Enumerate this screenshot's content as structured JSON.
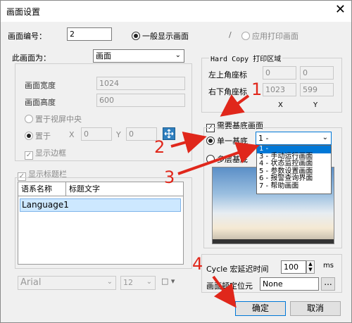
{
  "window": {
    "title": "画面设置",
    "close_glyph": "✕"
  },
  "screen_number": {
    "label": "画面编号：",
    "value": "2"
  },
  "mode": {
    "general_label": "一般显示画面",
    "print_label": "应用打印画面",
    "separator": "/"
  },
  "screen_type": {
    "label": "此画面为：",
    "value": "画面"
  },
  "size": {
    "width_label": "画面宽度",
    "width_value": "1024",
    "height_label": "画面高度",
    "height_value": "600"
  },
  "placement": {
    "center_label": "置于视屏中央",
    "place_label": "置于",
    "x_label": "X",
    "x_value": "0",
    "y_label": "Y",
    "y_value": "0"
  },
  "show_border_label": "显示边框",
  "show_title_bar_label": "显示标题栏",
  "title_table": {
    "headers": [
      "语系名称",
      "标题文字"
    ],
    "rows": [
      [
        "Language1",
        ""
      ]
    ]
  },
  "font": {
    "family": "Arial",
    "size": "12",
    "color_glyph": "□"
  },
  "hardcopy": {
    "label": "Hard Copy 打印区域",
    "top_left_label": "左上角座标",
    "bottom_right_label": "右下角座标",
    "tl_x": "0",
    "tl_y": "0",
    "br_x": "1023",
    "br_y": "599",
    "x_axis": "X",
    "y_axis": "Y"
  },
  "base": {
    "need_label": "需要基底画面",
    "single_label": "单一基底",
    "multi_label": "多层基底",
    "selected": "1 -"
  },
  "base_options": [
    "1 -",
    "3 - 手动运行画面",
    "4 - 状态监控画面",
    "5 - 参数设置画面",
    "6 - 报警查询界面",
    "7 - 帮助画面"
  ],
  "cycle": {
    "label": "Cycle 宏延迟时间",
    "value": "100",
    "unit": "ms"
  },
  "locate": {
    "label": "画面顿定位元",
    "value": "None",
    "btn": "..."
  },
  "buttons": {
    "ok": "确定",
    "cancel": "取消"
  },
  "annotations": [
    "1",
    "2",
    "3",
    "4"
  ],
  "colors": {
    "annotation": "#e0271b",
    "selection": "#0078d7"
  }
}
